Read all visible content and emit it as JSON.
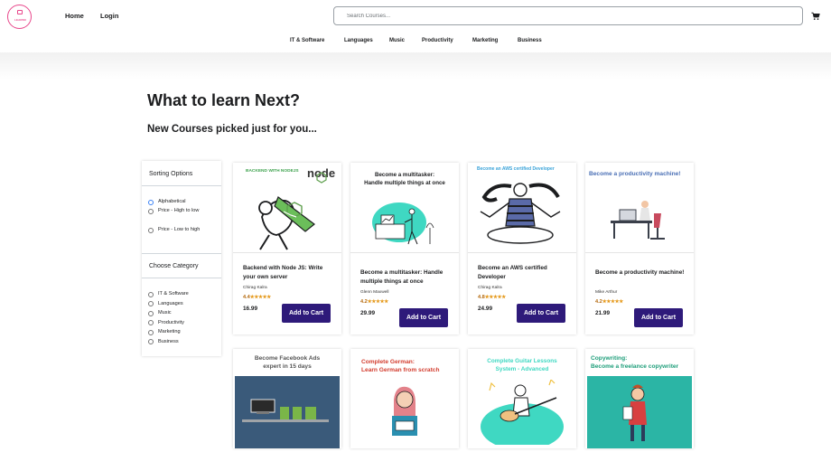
{
  "header": {
    "logo_text": "LEARNX",
    "nav": [
      "Home",
      "Login"
    ],
    "search_placeholder": "Search Courses...",
    "cart_icon": "cart-icon"
  },
  "categories_bar": [
    "IT & Software",
    "Languages",
    "Music",
    "Productivity",
    "Marketing",
    "Business"
  ],
  "headings": {
    "title": "What to learn Next?",
    "subtitle": "New Courses picked just for you..."
  },
  "sidebar": {
    "sorting_title": "Sorting Options",
    "sorting_options": [
      "Alphabetical",
      "Price - High to low",
      "Price - Low to high"
    ],
    "sorting_selected": "Alphabetical",
    "category_title": "Choose Category",
    "categories": [
      "IT & Software",
      "Languages",
      "Music",
      "Productivity",
      "Marketing",
      "Business"
    ]
  },
  "courses": [
    {
      "thumb_caption": "BACKEND WITH NODEJS",
      "thumb_logo": "node",
      "title": "Backend with Node JS: Write your own server",
      "author": "Chirag Kalra",
      "rating": "4.4",
      "stars": "★★★★★",
      "price": "16.99",
      "button": "Add to Cart"
    },
    {
      "thumb_caption": "Become a multitasker:\nHandle multiple things at once",
      "title": "Become a multitasker: Handle multiple things at once",
      "author": "Glenn Maxwell",
      "rating": "4.2",
      "stars": "★★★★★",
      "price": "29.99",
      "button": "Add to Cart"
    },
    {
      "thumb_caption": "Become an AWS certified Developer",
      "title": "Become an AWS certified Developer",
      "author": "Chirag Kalra",
      "rating": "4.8",
      "stars": "★★★★★",
      "price": "24.99",
      "button": "Add to Cart"
    },
    {
      "thumb_caption": "Become a productivity machine!",
      "title": "Become a productivity machine!",
      "author": "Mike Arthur",
      "rating": "4.2",
      "stars": "★★★★★",
      "price": "21.99",
      "button": "Add to Cart"
    }
  ],
  "courses_row2": [
    {
      "thumb_caption": "Become Facebook Ads\nexpert in 15 days"
    },
    {
      "thumb_caption": "Complete German:\nLearn German from scratch"
    },
    {
      "thumb_caption": "Complete Guitar Lessons\nSystem - Advanced"
    },
    {
      "thumb_caption": "Copywriting:\nBecome a freelance copywriter"
    }
  ],
  "colors": {
    "button": "#2e1a7a",
    "logo": "#e8478b",
    "rating": "#b4690e",
    "stars": "#e59819",
    "radio_selected": "#3b82f6"
  }
}
